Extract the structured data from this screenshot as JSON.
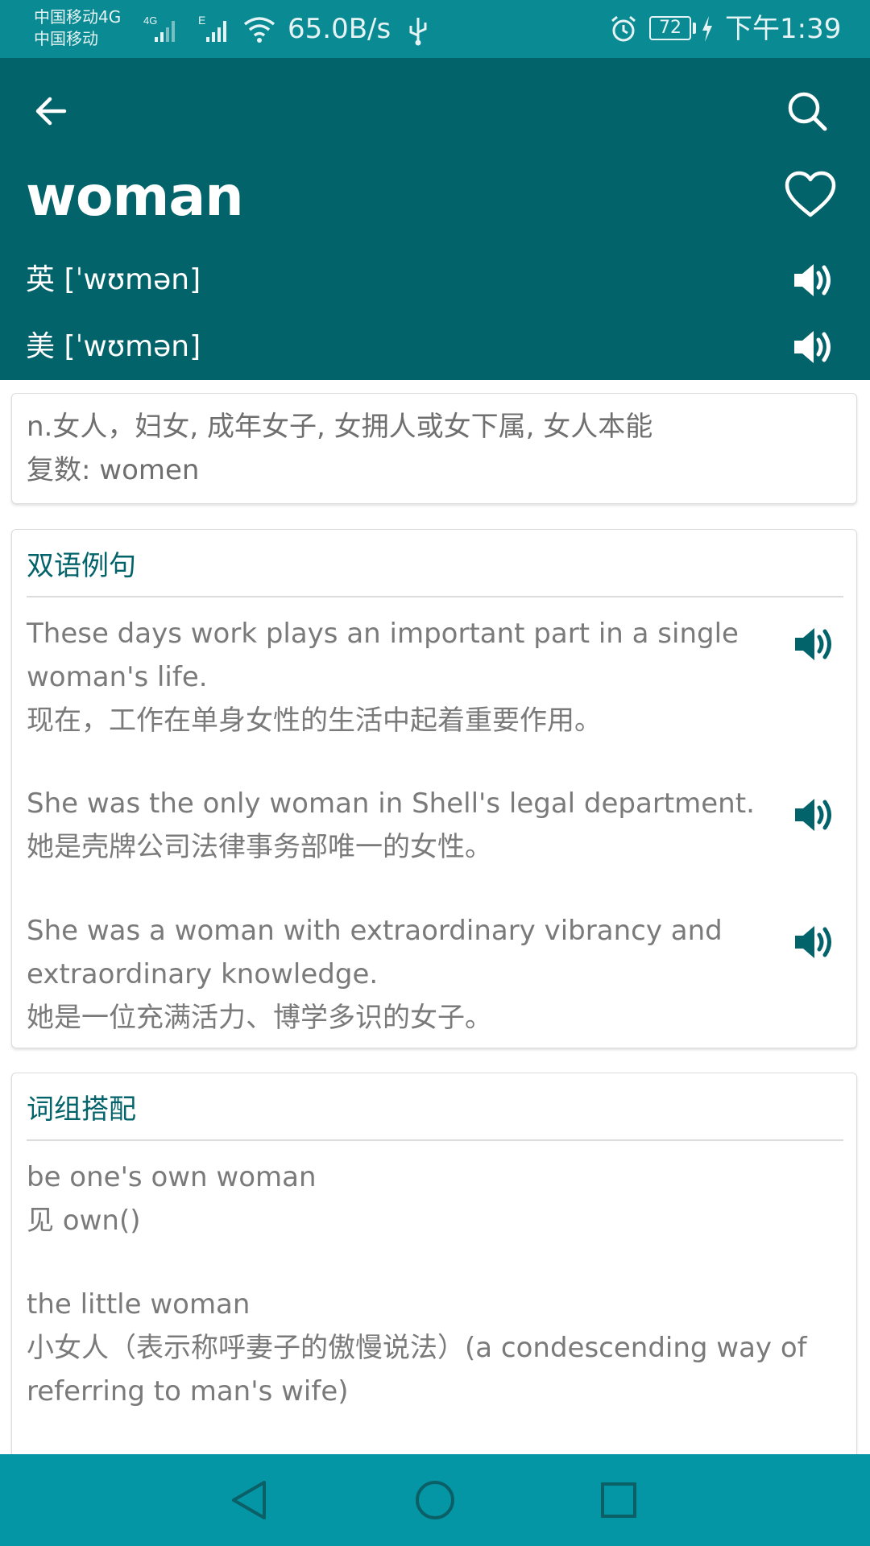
{
  "status_bar": {
    "carrier_line1": "中国移动4G",
    "carrier_line2": "中国移动",
    "net_speed": "65.0B/s",
    "battery_level": "72",
    "time": "下午1:39"
  },
  "header": {
    "word": "woman",
    "uk_phonetic": "英 [ˈwʊmən]",
    "us_phonetic": "美 [ˈwʊmən]"
  },
  "definition": {
    "meaning": "n.女人，妇女, 成年女子, 女拥人或女下属, 女人本能",
    "plural": "复数: women"
  },
  "examples": {
    "title": "双语例句",
    "items": [
      {
        "en": "These days work plays an important part in a single woman's life.",
        "zh": "现在，工作在单身女性的生活中起着重要作用。"
      },
      {
        "en": "She was the only woman in Shell's legal department.",
        "zh": "她是壳牌公司法律事务部唯一的女性。"
      },
      {
        "en": "She was a woman with extraordinary vibrancy and extraordinary knowledge.",
        "zh": "她是一位充满活力、博学多识的女子。"
      }
    ]
  },
  "phrases": {
    "title": "词组搭配",
    "items": [
      {
        "phrase": "be one's own woman",
        "meaning": "见 own()"
      },
      {
        "phrase": "the little woman",
        "meaning": "小女人（表示称呼妻子的傲慢说法）(a condescending way of referring to man's wife)"
      }
    ]
  },
  "icons": {
    "back": "arrow-left-icon",
    "search": "search-icon",
    "favorite": "heart-icon",
    "speaker": "speaker-icon"
  },
  "colors": {
    "status_bar": "#0a8b94",
    "header": "#03636a",
    "accent": "#03636a",
    "nav_bar": "#0596a6"
  }
}
